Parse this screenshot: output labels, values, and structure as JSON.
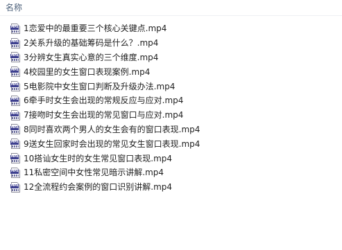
{
  "header": {
    "name_column_label": "名称"
  },
  "file_icon": {
    "name": "mp4-file-icon",
    "tag_text": "MP4"
  },
  "files": [
    {
      "name": "1恋爱中的最重要三个核心关键点.mp4"
    },
    {
      "name": "2关系升级的基础筹码是什么？.mp4"
    },
    {
      "name": "3分辨女生真实心意的三个维度.mp4"
    },
    {
      "name": "4校园里的女生窗口表现案例.mp4"
    },
    {
      "name": "5电影院中女生窗口判断及升级办法.mp4"
    },
    {
      "name": "6牵手时女生会出现的常规反应与应对.mp4"
    },
    {
      "name": "7接吻时女生会出现的常见窗口与应对.mp4"
    },
    {
      "name": "8同时喜欢两个男人的女生会有的窗口表现.mp4"
    },
    {
      "name": "9送女生回家时会出现的常见女生窗口表现.mp4"
    },
    {
      "name": "10搭讪女生时的女生常见窗口表现.mp4"
    },
    {
      "name": "11私密空间中女性常见暗示讲解.mp4"
    },
    {
      "name": "12全流程约会案例的窗口识别讲解.mp4"
    }
  ]
}
